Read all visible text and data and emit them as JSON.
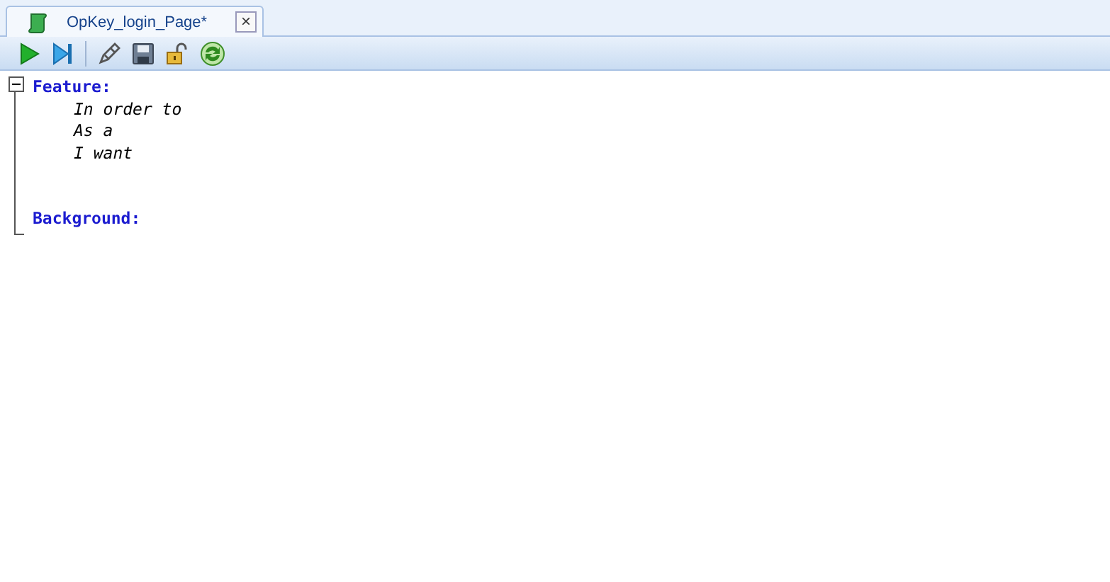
{
  "tabs": [
    {
      "title": "OpKey_login_Page*",
      "selected": true,
      "close": "×"
    }
  ],
  "toolbar": [
    {
      "kind": "run"
    },
    {
      "kind": "step"
    },
    {
      "kind": "separator"
    },
    {
      "kind": "edit"
    },
    {
      "kind": "save"
    },
    {
      "kind": "unlock"
    },
    {
      "kind": "refresh"
    }
  ],
  "editor": {
    "expanded": true,
    "lines": [
      {
        "kind": "keyword",
        "text": "Feature:",
        "spaced": false
      },
      {
        "kind": "step",
        "text": "In order to",
        "spaced": false
      },
      {
        "kind": "step",
        "text": "As a",
        "spaced": false
      },
      {
        "kind": "step",
        "text": "I want",
        "spaced": false
      },
      {
        "kind": "keyword",
        "text": "Background:",
        "spaced": true
      }
    ]
  }
}
